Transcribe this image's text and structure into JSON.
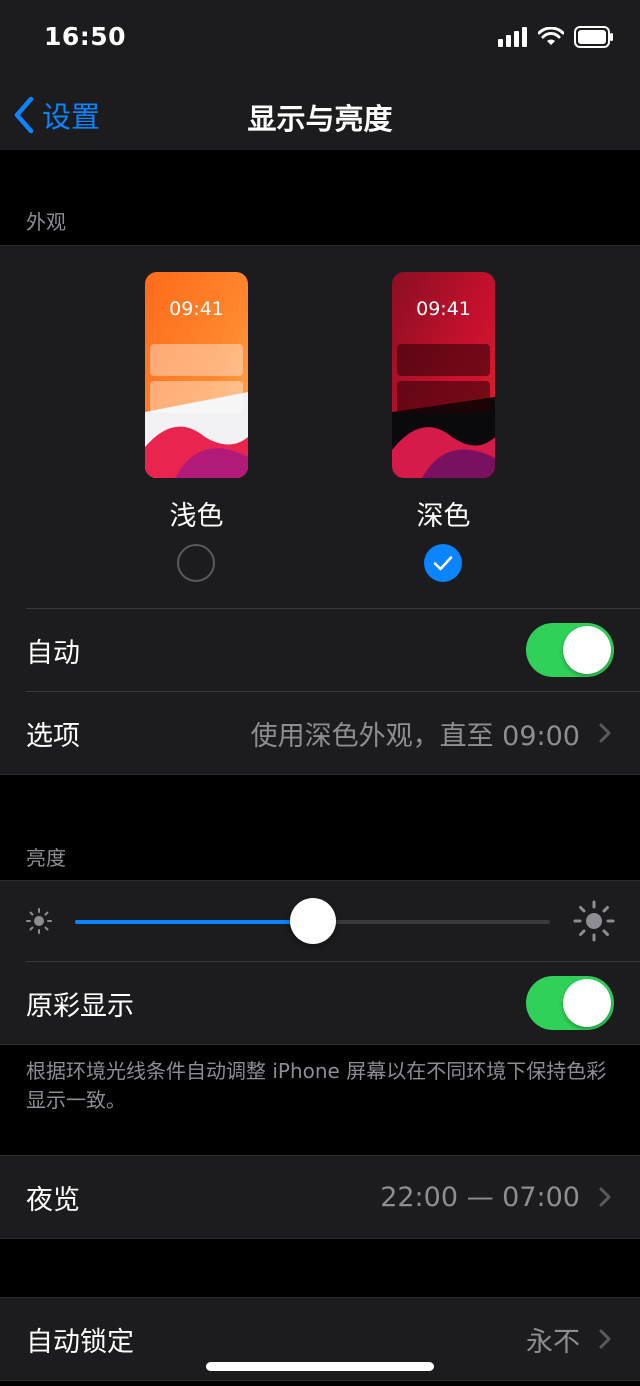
{
  "status_bar": {
    "time": "16:50"
  },
  "nav": {
    "back_label": "设置",
    "title": "显示与亮度"
  },
  "appearance": {
    "header": "外观",
    "light": {
      "preview_time": "09:41",
      "label": "浅色",
      "selected": false
    },
    "dark": {
      "preview_time": "09:41",
      "label": "深色",
      "selected": true
    },
    "auto_label": "自动",
    "auto_on": true,
    "options_label": "选项",
    "options_value": "使用深色外观，直至 09:00"
  },
  "brightness": {
    "header": "亮度",
    "level": 0.5,
    "true_tone_label": "原彩显示",
    "true_tone_on": true,
    "footnote": "根据环境光线条件自动调整 iPhone 屏幕以在不同环境下保持色彩显示一致。"
  },
  "night_shift": {
    "label": "夜览",
    "value": "22:00 — 07:00"
  },
  "auto_lock": {
    "label": "自动锁定",
    "value": "永不"
  },
  "colors": {
    "accent": "#0a84ff",
    "toggle_on": "#30d158",
    "group_bg": "#1c1c1e",
    "secondary_text": "#8d8d93"
  }
}
